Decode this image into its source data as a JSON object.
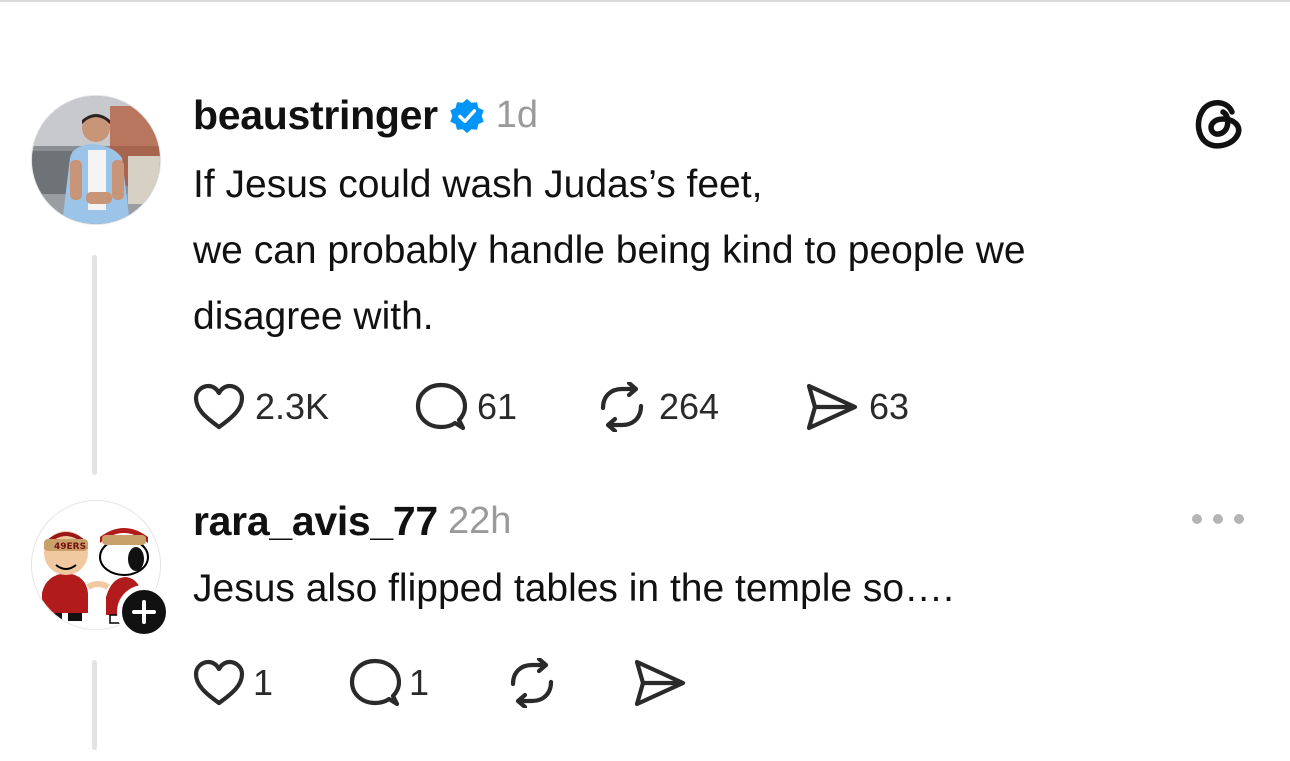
{
  "posts": [
    {
      "username": "beaustringer",
      "verified": true,
      "time": "1d",
      "text_lines": [
        "If Jesus could wash Judas’s feet,",
        "we can probably handle being kind to people we",
        "disagree with."
      ],
      "actions": {
        "likes": "2.3K",
        "replies": "61",
        "reposts": "264",
        "shares": "63"
      }
    },
    {
      "username": "rara_avis_77",
      "time": "22h",
      "text": "Jesus also flipped tables in the temple so….",
      "actions": {
        "likes": "1",
        "replies": "1"
      }
    }
  ],
  "avatar_badge_text": "49ERS",
  "icons": {
    "app_logo": "threads-logo-icon",
    "verified": "verified-badge-icon",
    "like": "heart-icon",
    "reply": "comment-bubble-icon",
    "repost": "repost-icon",
    "share": "send-icon",
    "more": "more-options-icon",
    "follow": "plus-icon"
  },
  "colors": {
    "text": "#111111",
    "muted": "#9a9a9a",
    "verified_blue": "#0095f6",
    "thread_line": "#e3e3e3"
  }
}
